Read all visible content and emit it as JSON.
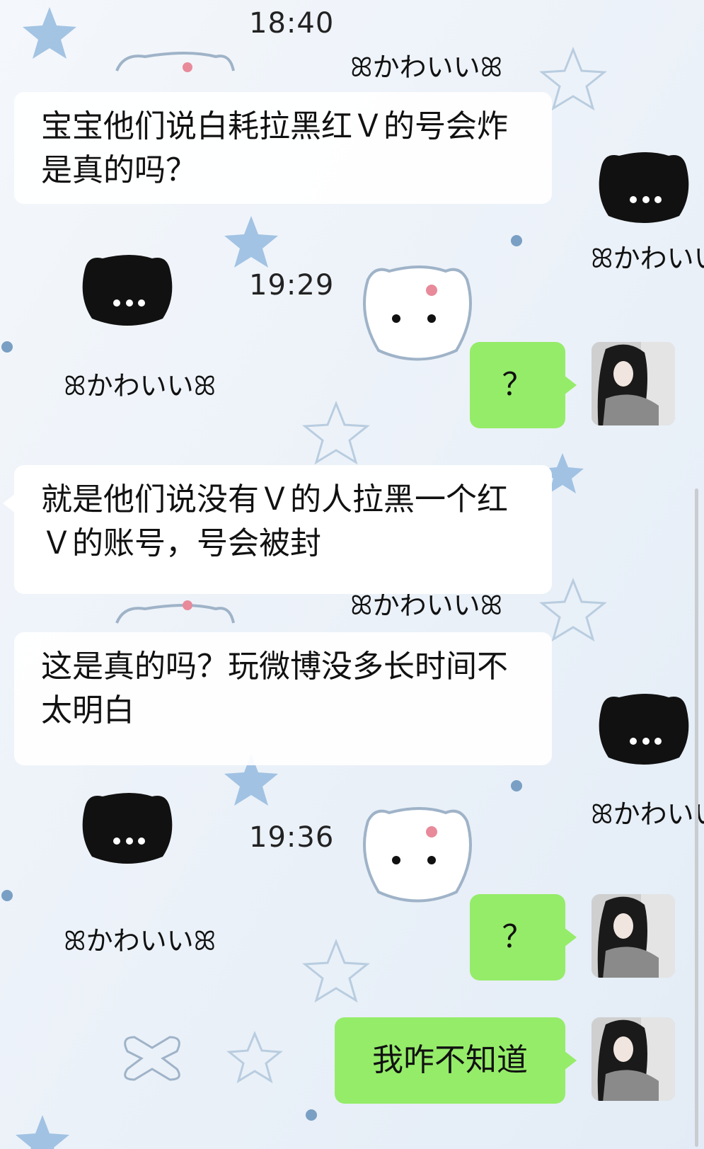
{
  "chat": {
    "messages": [
      {
        "type": "time",
        "text": "18:40"
      },
      {
        "type": "in",
        "text": "宝宝他们说白耗拉黑红Ｖ的号会炸是真的吗？"
      },
      {
        "type": "time",
        "text": "19:29"
      },
      {
        "type": "out",
        "text": "？"
      },
      {
        "type": "in",
        "text": "就是他们说没有Ｖ的人拉黑一个红Ｖ的账号，号会被封"
      },
      {
        "type": "in",
        "text": "这是真的吗？玩微博没多长时间不太明白"
      },
      {
        "type": "time",
        "text": "19:36"
      },
      {
        "type": "out",
        "text": "？"
      },
      {
        "type": "out",
        "text": "我咋不知道"
      }
    ]
  },
  "background": {
    "sticker_text": "ꕤかわいいꕤ",
    "colors": {
      "bg": "#eef3f8",
      "cat": "#111111",
      "star": "#8fb6dd",
      "bow": "#e88a9a"
    }
  },
  "colors": {
    "out_bubble": "#95ec69",
    "in_bubble": "#ffffff"
  }
}
